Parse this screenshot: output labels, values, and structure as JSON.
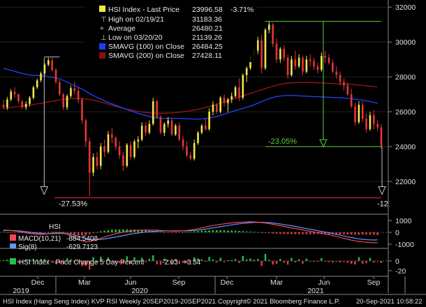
{
  "chart_data": {
    "type": "candlestick",
    "x_axis": {
      "month_labels": [
        "Dec",
        "Mar",
        "Jun",
        "Sep",
        "Dec",
        "Mar",
        "Jun",
        "Sep"
      ],
      "year_labels": [
        "2019",
        "2020",
        "2021"
      ]
    },
    "price_axis": {
      "ticks": [
        22000,
        24000,
        26000,
        28000,
        30000,
        32000
      ],
      "ylim": [
        20400,
        32250
      ]
    },
    "legend": {
      "title": "HSI Index - Last Price",
      "title_value": "23996.58",
      "title_change": "-3.71%",
      "rows": [
        {
          "label": "High on 02/19/21",
          "value": "31183.36",
          "marker": "tick"
        },
        {
          "label": "Average",
          "value": "26480.21",
          "marker": "plus"
        },
        {
          "label": "Low on 03/20/20",
          "value": "21139.26",
          "marker": "tick"
        },
        {
          "label": "SMAVG (100)  on Close",
          "value": "26484.25",
          "marker": "blue"
        },
        {
          "label": "SMAVG (200)  on Close",
          "value": "27428.11",
          "marker": "darkred"
        }
      ]
    },
    "candles": [
      [
        26400,
        26700,
        26150,
        26250
      ],
      [
        26250,
        26850,
        26100,
        26700
      ],
      [
        26700,
        27300,
        26600,
        27150
      ],
      [
        27150,
        27400,
        26800,
        27000
      ],
      [
        27000,
        27050,
        26500,
        26600
      ],
      [
        26600,
        26700,
        26150,
        26250
      ],
      [
        26250,
        26600,
        26100,
        26450
      ],
      [
        26450,
        26900,
        26300,
        26800
      ],
      [
        26800,
        27500,
        26700,
        27400
      ],
      [
        27400,
        27900,
        27300,
        27800
      ],
      [
        27800,
        28300,
        27700,
        28200
      ],
      [
        28200,
        28800,
        28100,
        28700
      ],
      [
        28700,
        29100,
        28600,
        28950
      ],
      [
        28950,
        29100,
        28300,
        28400
      ],
      [
        28400,
        28500,
        27600,
        27700
      ],
      [
        27700,
        27800,
        26900,
        27000
      ],
      [
        27000,
        27100,
        26100,
        26250
      ],
      [
        26250,
        27000,
        26100,
        26900
      ],
      [
        26900,
        27500,
        26800,
        27350
      ],
      [
        27350,
        27700,
        27000,
        27200
      ],
      [
        27200,
        27400,
        26500,
        26700
      ],
      [
        26700,
        26800,
        25300,
        25500
      ],
      [
        25500,
        25600,
        24000,
        24300
      ],
      [
        24300,
        24500,
        21139,
        22500
      ],
      [
        22500,
        23600,
        22300,
        23400
      ],
      [
        23400,
        23700,
        22700,
        22900
      ],
      [
        22900,
        24200,
        22700,
        24000
      ],
      [
        24000,
        24400,
        23400,
        23700
      ],
      [
        23700,
        24900,
        23600,
        24700
      ],
      [
        24700,
        25100,
        24200,
        24500
      ],
      [
        24500,
        24600,
        23800,
        24000
      ],
      [
        24000,
        24300,
        23300,
        23500
      ],
      [
        23500,
        23700,
        22600,
        22900
      ],
      [
        22900,
        24200,
        22800,
        24100
      ],
      [
        24100,
        24300,
        23200,
        23400
      ],
      [
        23400,
        24400,
        23300,
        24300
      ],
      [
        24300,
        24600,
        23900,
        24400
      ],
      [
        24400,
        25400,
        24300,
        25200
      ],
      [
        25200,
        25400,
        24600,
        24800
      ],
      [
        24800,
        25500,
        24700,
        25300
      ],
      [
        25300,
        26800,
        25200,
        26600
      ],
      [
        26600,
        26700,
        25600,
        25700
      ],
      [
        25700,
        25800,
        24700,
        24800
      ],
      [
        24800,
        25400,
        24600,
        25300
      ],
      [
        25300,
        25700,
        25100,
        25500
      ],
      [
        25500,
        25600,
        24600,
        24700
      ],
      [
        24700,
        25300,
        24600,
        25200
      ],
      [
        25200,
        25400,
        24300,
        24400
      ],
      [
        24400,
        24600,
        23800,
        24000
      ],
      [
        24000,
        24300,
        23400,
        23500
      ],
      [
        23500,
        23700,
        23200,
        23300
      ],
      [
        23300,
        24400,
        23200,
        24200
      ],
      [
        24200,
        24900,
        24100,
        24800
      ],
      [
        24800,
        25300,
        24700,
        25200
      ],
      [
        25200,
        25600,
        24900,
        25000
      ],
      [
        25000,
        26200,
        24900,
        26000
      ],
      [
        26000,
        26600,
        25800,
        26400
      ],
      [
        26400,
        26500,
        25900,
        26000
      ],
      [
        26000,
        26900,
        25900,
        26800
      ],
      [
        26800,
        27000,
        26300,
        26500
      ],
      [
        26500,
        26800,
        26000,
        26700
      ],
      [
        26700,
        27100,
        26500,
        26900
      ],
      [
        26900,
        27500,
        26800,
        27400
      ],
      [
        27400,
        27900,
        26600,
        26800
      ],
      [
        26800,
        28200,
        26700,
        28100
      ],
      [
        28100,
        28600,
        27700,
        28500
      ],
      [
        28500,
        29300,
        28400,
        29200
      ],
      [
        29200,
        29700,
        28900,
        29500
      ],
      [
        29500,
        30300,
        29300,
        30100
      ],
      [
        30100,
        30400,
        28200,
        28500
      ],
      [
        28500,
        30800,
        28400,
        30700
      ],
      [
        30700,
        31183,
        30500,
        31000
      ],
      [
        31000,
        31100,
        29700,
        29900
      ],
      [
        29900,
        30200,
        28800,
        29000
      ],
      [
        29000,
        29700,
        28800,
        29600
      ],
      [
        29600,
        29800,
        28900,
        29100
      ],
      [
        29100,
        29300,
        27900,
        28100
      ],
      [
        28100,
        29200,
        28000,
        29000
      ],
      [
        29000,
        29500,
        28400,
        28600
      ],
      [
        28600,
        29300,
        28500,
        29100
      ],
      [
        29100,
        29200,
        28100,
        28300
      ],
      [
        28300,
        29200,
        28200,
        29000
      ],
      [
        29000,
        29300,
        28600,
        28900
      ],
      [
        28900,
        29100,
        28400,
        28600
      ],
      [
        28600,
        28800,
        28200,
        28400
      ],
      [
        28400,
        29400,
        28300,
        29200
      ],
      [
        29200,
        29500,
        28800,
        29100
      ],
      [
        29100,
        29300,
        28700,
        28800
      ],
      [
        28800,
        29000,
        28200,
        28300
      ],
      [
        28300,
        28600,
        27900,
        28100
      ],
      [
        28100,
        28300,
        27500,
        27700
      ],
      [
        27700,
        27900,
        27200,
        27500
      ],
      [
        27500,
        27700,
        26900,
        27000
      ],
      [
        27000,
        27300,
        26200,
        26300
      ],
      [
        26300,
        26500,
        25200,
        25400
      ],
      [
        25400,
        26600,
        25300,
        26400
      ],
      [
        26400,
        26600,
        25400,
        25600
      ],
      [
        25600,
        25900,
        24800,
        25000
      ],
      [
        25000,
        26000,
        24900,
        25800
      ],
      [
        25800,
        26100,
        25000,
        25300
      ],
      [
        25300,
        25500,
        24900,
        25100
      ],
      [
        25100,
        25300,
        23900,
        23997
      ]
    ],
    "sma100": [
      28480,
      28440,
      28380,
      28320,
      28260,
      28200,
      28150,
      28110,
      28090,
      28080,
      28060,
      28040,
      28010,
      27980,
      27930,
      27880,
      27800,
      27700,
      27600,
      27500,
      27400,
      27300,
      27180,
      27050,
      26930,
      26820,
      26720,
      26620,
      26530,
      26450,
      26370,
      26290,
      26210,
      26130,
      26050,
      25980,
      25910,
      25850,
      25790,
      25730,
      25680,
      25650,
      25630,
      25620,
      25620,
      25620,
      25620,
      25620,
      25610,
      25600,
      25590,
      25580,
      25580,
      25590,
      25610,
      25640,
      25680,
      25730,
      25790,
      25860,
      25930,
      26000,
      26070,
      26130,
      26190,
      26250,
      26320,
      26400,
      26490,
      26580,
      26670,
      26750,
      26820,
      26870,
      26900,
      26920,
      26930,
      26930,
      26920,
      26910,
      26900,
      26890,
      26880,
      26870,
      26860,
      26850,
      26840,
      26830,
      26820,
      26810,
      26800,
      26790,
      26770,
      26750,
      26720,
      26690,
      26660,
      26620,
      26580,
      26530,
      26480
    ],
    "sma200": [
      26180,
      26210,
      26240,
      26270,
      26300,
      26330,
      26360,
      26390,
      26420,
      26450,
      26480,
      26520,
      26560,
      26600,
      26640,
      26680,
      26710,
      26730,
      26750,
      26760,
      26760,
      26750,
      26730,
      26700,
      26660,
      26610,
      26550,
      26490,
      26430,
      26370,
      26310,
      26250,
      26200,
      26150,
      26100,
      26060,
      26020,
      25990,
      25960,
      25940,
      25920,
      25910,
      25910,
      25910,
      25920,
      25930,
      25950,
      25970,
      26000,
      26030,
      26060,
      26100,
      26140,
      26190,
      26240,
      26300,
      26360,
      26420,
      26490,
      26560,
      26630,
      26700,
      26770,
      26840,
      26910,
      26980,
      27050,
      27120,
      27190,
      27260,
      27330,
      27400,
      27460,
      27520,
      27570,
      27610,
      27640,
      27660,
      27670,
      27680,
      27680,
      27680,
      27680,
      27670,
      27660,
      27650,
      27640,
      27630,
      27620,
      27610,
      27600,
      27590,
      27580,
      27570,
      27550,
      27530,
      27510,
      27490,
      27470,
      27440,
      27428
    ],
    "annotations": {
      "pct_left": "-27.53%",
      "pct_right": "-23.05%",
      "pct_edge": "-12"
    },
    "macd_panel": {
      "ticks": [
        1000,
        0,
        -1000
      ],
      "header": "HSI",
      "rows": [
        {
          "label": "MACD(10,21)",
          "value": "-884.5408"
        },
        {
          "label": "Sig(8)",
          "value": "-629.7123"
        }
      ],
      "macd": [
        200,
        180,
        150,
        120,
        80,
        20,
        -40,
        -80,
        -120,
        -150,
        -160,
        -150,
        -120,
        -80,
        -50,
        -40,
        -60,
        -150,
        -300,
        -450,
        -600,
        -720,
        -800,
        -780,
        -700,
        -600,
        -500,
        -400,
        -300,
        -200,
        -120,
        -50,
        20,
        80,
        120,
        160,
        180,
        190,
        200,
        200,
        190,
        180,
        160,
        140,
        120,
        110,
        100,
        110,
        130,
        160,
        200,
        250,
        310,
        380,
        450,
        520,
        580,
        630,
        680,
        720,
        760,
        800,
        830,
        850,
        870,
        880,
        890,
        880,
        860,
        830,
        790,
        740,
        680,
        620,
        560,
        500,
        440,
        380,
        320,
        260,
        200,
        140,
        80,
        30,
        -20,
        -80,
        -140,
        -200,
        -270,
        -350,
        -430,
        -510,
        -590,
        -660,
        -720,
        -770,
        -810,
        -840,
        -860,
        -875,
        -884
      ],
      "signal": [
        150,
        160,
        160,
        150,
        130,
        100,
        60,
        20,
        -20,
        -60,
        -90,
        -110,
        -120,
        -115,
        -105,
        -95,
        -90,
        -110,
        -160,
        -240,
        -330,
        -430,
        -520,
        -590,
        -620,
        -620,
        -600,
        -560,
        -510,
        -450,
        -390,
        -330,
        -270,
        -210,
        -150,
        -100,
        -60,
        -20,
        20,
        50,
        80,
        100,
        115,
        125,
        130,
        130,
        128,
        125,
        125,
        130,
        140,
        160,
        190,
        230,
        280,
        330,
        380,
        430,
        480,
        530,
        580,
        630,
        680,
        720,
        760,
        790,
        820,
        840,
        850,
        850,
        840,
        820,
        790,
        750,
        710,
        660,
        610,
        560,
        500,
        440,
        380,
        320,
        260,
        200,
        140,
        80,
        20,
        -40,
        -100,
        -170,
        -240,
        -310,
        -380,
        -440,
        -500,
        -550,
        -590,
        -620,
        -640,
        -650,
        -630
      ]
    },
    "change_panel": {
      "ticks": [
        0,
        -20
      ],
      "label": "HSI Index - Price Change 5 Day Percent",
      "value": "-2.03",
      "value2": "+3.54",
      "values": [
        0.5,
        1.2,
        2.0,
        -0.6,
        -1.8,
        -1.2,
        0.8,
        1.6,
        2.2,
        1.5,
        1.8,
        2.0,
        1.0,
        -0.4,
        -2.8,
        -2.5,
        -3.0,
        2.6,
        1.6,
        -0.6,
        -1.6,
        -5.2,
        -4.8,
        -8.6,
        3.8,
        -1.8,
        4.2,
        -0.8,
        3.4,
        -0.7,
        -1.9,
        -2.2,
        -3.1,
        4.6,
        -2.8,
        3.6,
        0.7,
        3.2,
        -1.2,
        2.1,
        5.6,
        -3.4,
        -3.8,
        2.4,
        0.9,
        -3.0,
        1.9,
        -3.0,
        -1.6,
        -2.0,
        -0.7,
        3.6,
        2.4,
        1.6,
        -0.8,
        4.0,
        1.5,
        -1.5,
        3.2,
        -1.2,
        0.8,
        0.9,
        1.9,
        -2.1,
        5.0,
        1.4,
        2.4,
        1.2,
        2.1,
        -5.0,
        7.0,
        1.2,
        -3.6,
        -3.0,
        2.0,
        -1.6,
        -3.7,
        3.1,
        -1.4,
        1.8,
        -2.8,
        2.4,
        -0.3,
        -1.0,
        -0.7,
        2.8,
        -0.3,
        -1.0,
        -1.7,
        -0.8,
        -1.4,
        -1.0,
        -1.8,
        -2.7,
        -3.5,
        3.8,
        -2.7,
        -2.3,
        3.0,
        -1.6,
        -0.7,
        -2.0
      ]
    }
  },
  "footer": {
    "left": "HSI Index (Hang Seng Index) KVP RSI  Weekly 20SEP2019-20SEP2021",
    "mid": "Copyright© 2021 Bloomberg Finance L.P.",
    "right": "20-Sep-2021 10:58:22"
  }
}
